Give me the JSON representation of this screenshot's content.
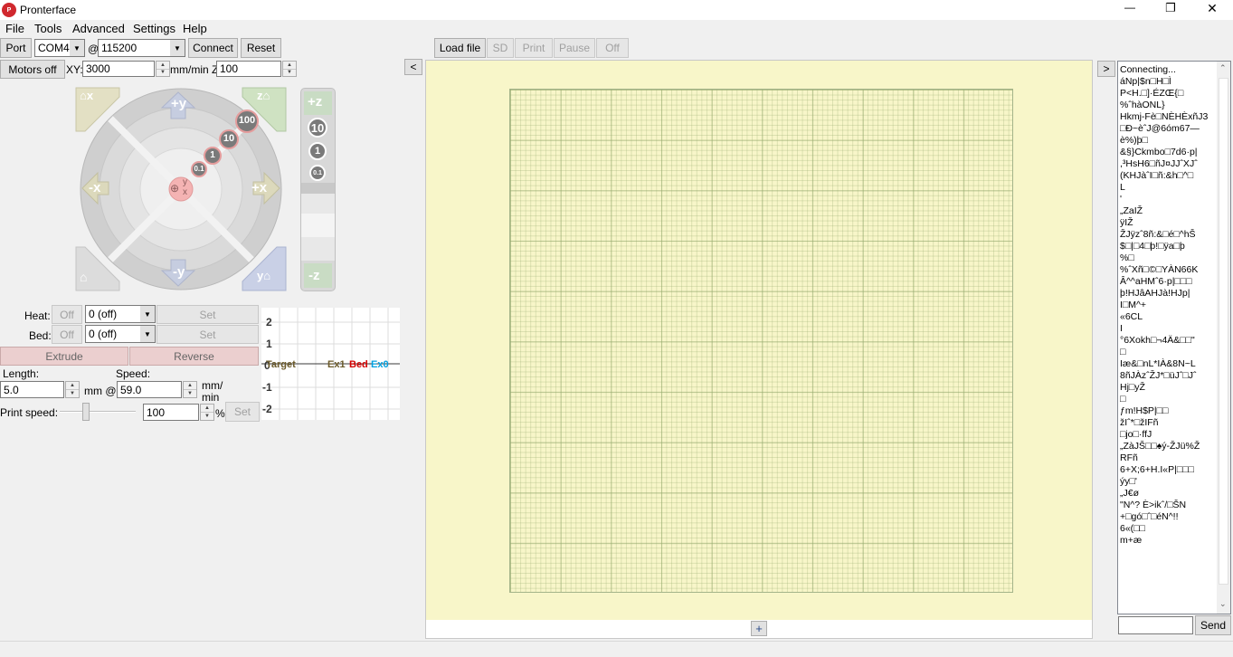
{
  "window": {
    "title": "Pronterface",
    "minimize": "—",
    "restore": "❐",
    "close": "✕"
  },
  "menu": [
    "File",
    "Tools",
    "Advanced",
    "Settings",
    "Help"
  ],
  "connection": {
    "port_label": "Port",
    "port_value": "COM4",
    "at": "@",
    "baud_value": "115200",
    "connect_label": "Connect",
    "reset_label": "Reset"
  },
  "motors": {
    "motors_off_label": "Motors off",
    "xy_label": "XY:",
    "xy_value": "3000",
    "z_label": "mm/min Z:",
    "z_value": "100"
  },
  "jog": {
    "xy_steps": [
      "100",
      "10",
      "1",
      "0.1"
    ],
    "z_steps": [
      "10",
      "1",
      "0.1"
    ],
    "labels": {
      "plus_y": "+y",
      "minus_y": "-y",
      "plus_x": "+x",
      "minus_x": "-x",
      "plus_z": "+z",
      "minus_z": "-z",
      "home_x": "x",
      "home_y": "y",
      "home_z": "z",
      "center_y": "y",
      "center_x": "x"
    }
  },
  "temps": {
    "heat_label": "Heat:",
    "bed_label": "Bed:",
    "off_label": "Off",
    "heat_value": "0 (off)",
    "bed_value": "0 (off)",
    "set_label": "Set"
  },
  "extrude": {
    "extrude_label": "Extrude",
    "reverse_label": "Reverse",
    "length_label": "Length:",
    "speed_label": "Speed:",
    "length_value": "5.0",
    "length_unit": "mm @",
    "speed_value": "59.0",
    "speed_unit_1": "mm/",
    "speed_unit_2": "min"
  },
  "print_speed": {
    "label": "Print speed:",
    "value": "100",
    "unit": "%",
    "set_label": "Set",
    "slider_fraction": 0.33
  },
  "temp_graph": {
    "y_ticks": [
      "2",
      "1",
      "0",
      "-1",
      "-2"
    ],
    "target_label": "Target",
    "ex1_label": "Ex1",
    "bed_label": "Bed",
    "ex0_label": "Ex0"
  },
  "toolbar": {
    "load_file": "Load file",
    "sd": "SD",
    "print": "Print",
    "pause": "Pause",
    "off": "Off",
    "collapse_left": "<",
    "collapse_right": ">"
  },
  "plater": {
    "add_label": "+"
  },
  "console": {
    "lines": [
      "Connecting...",
      "áNp|$n□H□Ì",
      "P<H.□]·ÉZŒ{□",
      "%ˆhàONL}",
      "Hkmj-Fè□NÈHÈxñJ3",
      "□Ð~èˆJ@6óm67—",
      "è%)þ□",
      "&§}Ckmbo□7d6·p|",
      ",³HsH6□ñJ¤JJˆXJˆ",
      "(KHJàˆI□ñ:&h□^□",
      "L",
      "'",
      "„ZaIŽ",
      "ÿIŽ",
      "ŽJÿzˆ8ñ:&□é□^hŠ",
      "$□|□4□þ!□ÿa□þ",
      "%□",
      "%ˆXñ□©□YÀN66K",
      "Â^^aHMˆ6·p|□□□",
      "þ!HJâAHJà!HJp|",
      "I□M^+",
      "«6CL",
      "I",
      "°6Xokh□¬4Ä&□□\"",
      "□",
      "Iæ&□nL*IÀ&8N~L",
      "8ñJÀzˆŽJ*□üJˆ□Jˆ",
      "Hj□yŽ",
      "□",
      "ƒm!H$P|□□",
      "žIˆ*□žIFñ",
      "□jo□·ffJ",
      "„ZàJŠ□□♠ý-ŽJü%Ž",
      "RFñ",
      "6+X;6+H.I«P|□□□",
      "ýy□'",
      "„J€ø",
      "\"N^? È>ikˆ/□ŠN",
      " +□gó□ˆ□éN^!!",
      "6«(□□",
      "m+æ"
    ],
    "send_label": "Send",
    "input_value": ""
  },
  "colors": {
    "plater_bg": "#f8f6c9",
    "grid_line": "#c4cfa3",
    "grid_major": "#a4b48a",
    "accent_red": "#d40000",
    "accent_blue": "#00a0e0"
  }
}
